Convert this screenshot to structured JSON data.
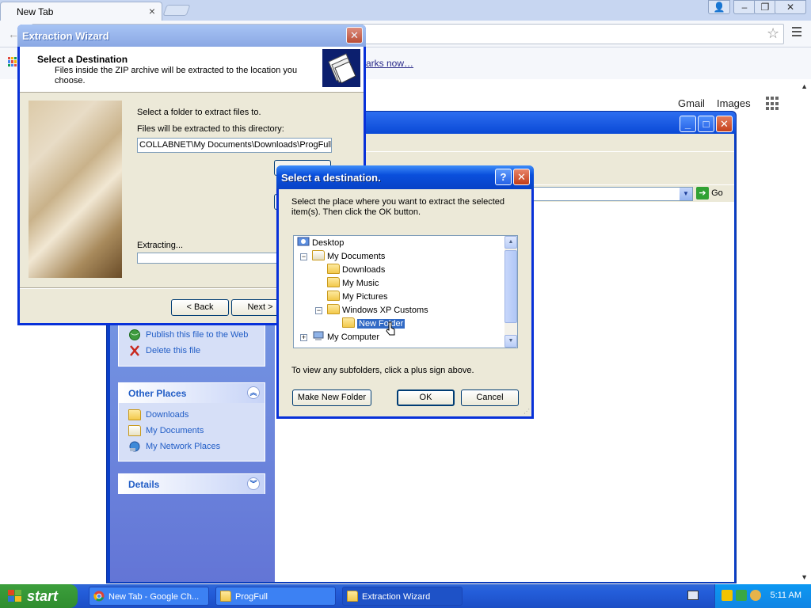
{
  "chrome": {
    "tab_title": "New Tab",
    "tab_close": "×",
    "win_user": "👤",
    "win_min": "–",
    "win_max": "❐",
    "win_close": "✕",
    "bookmark_link": "arks now…",
    "gmail": "Gmail",
    "images": "Images"
  },
  "explorer": {
    "go_label": "Go",
    "file_tasks": [
      {
        "label": "Publish this file to the Web"
      },
      {
        "label": "Delete this file"
      }
    ],
    "other_places": {
      "title": "Other Places",
      "items": [
        {
          "label": "Downloads"
        },
        {
          "label": "My Documents"
        },
        {
          "label": "My Network Places"
        }
      ]
    },
    "details": {
      "title": "Details"
    }
  },
  "wizard": {
    "title": "Extraction Wizard",
    "header_title": "Select a Destination",
    "header_subtitle": "Files inside the ZIP archive will be extracted to the location you choose.",
    "select_folder_label": "Select a folder to extract files to.",
    "directory_label": "Files will be extracted to this directory:",
    "path_value": "COLLABNET\\My Documents\\Downloads\\ProgFull",
    "extracting_label": "Extracting...",
    "back_label": "< Back",
    "next_label": "Next >"
  },
  "dest": {
    "title": "Select a destination.",
    "help": "?",
    "close": "✕",
    "instructions": "Select the place where you want to extract the selected item(s).  Then click the OK button.",
    "tree": {
      "desktop": "Desktop",
      "my_documents": "My Documents",
      "downloads": "Downloads",
      "my_music": "My Music",
      "my_pictures": "My Pictures",
      "xp_customs": "Windows XP Customs",
      "new_folder": "New Folder",
      "my_computer": "My Computer"
    },
    "hint": "To view any subfolders, click a plus sign above.",
    "make_new_folder": "Make New Folder",
    "ok": "OK",
    "cancel": "Cancel"
  },
  "taskbar": {
    "start": "start",
    "buttons": [
      {
        "label": "New Tab - Google Ch..."
      },
      {
        "label": "ProgFull"
      },
      {
        "label": "Extraction Wizard"
      }
    ],
    "clock": "5:11 AM"
  },
  "colors": {
    "xp_blue": "#0a49d6",
    "selection": "#316ac5",
    "start_green": "#3c9f3c"
  }
}
